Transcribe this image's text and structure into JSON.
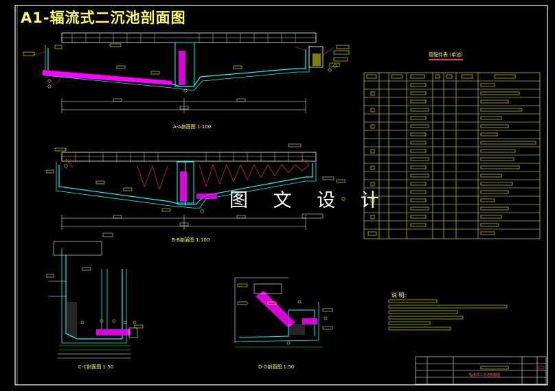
{
  "drawing": {
    "title": "A1-辐流式二沉池剖面图",
    "watermark": "图 文 设 计"
  },
  "sections": [
    {
      "id": "a",
      "label": "A-A剖面图 1:100"
    },
    {
      "id": "b",
      "label": "B-B剖面图 1:100"
    },
    {
      "id": "c",
      "label": "C-C剖面图 1:50"
    },
    {
      "id": "d",
      "label": "D-D剖面图 1:50"
    }
  ],
  "material_table": {
    "title": "管配件表 (单池)",
    "rows": 20,
    "columns": 8
  },
  "notes": {
    "title": "说 明:"
  },
  "title_block": {
    "drawing_name": "辐流式二沉池剖面图"
  },
  "colors": {
    "background": "#000000",
    "frame": "#ffffff",
    "annotation": "#ffff00",
    "pipe": "#ff00ff",
    "structure": "#00ffff",
    "dimension": "#ffffff",
    "leader": "#ff3333",
    "ground": "#00ff00"
  }
}
